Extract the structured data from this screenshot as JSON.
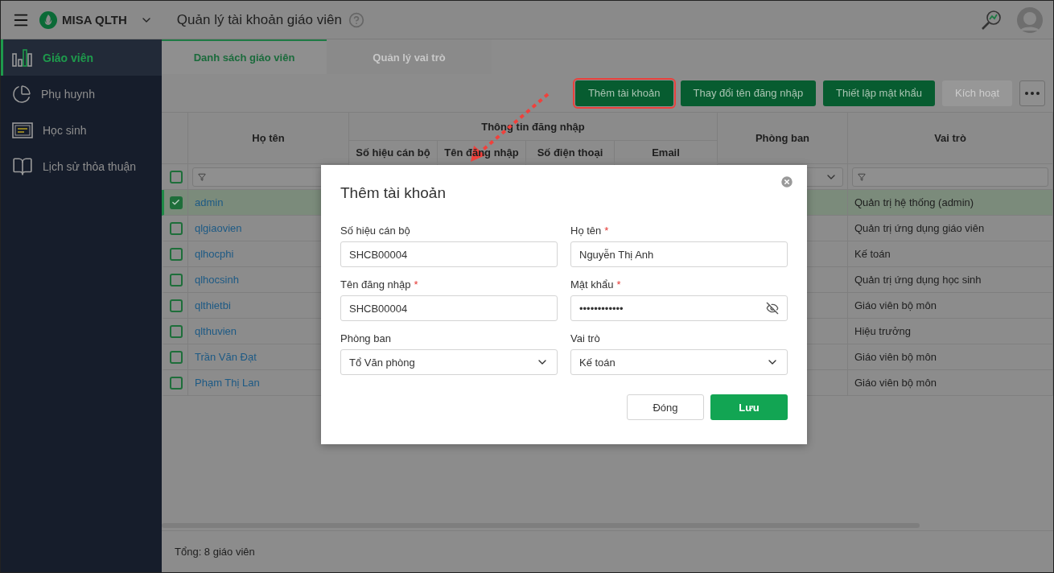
{
  "header": {
    "app_name": "MISA QLTH",
    "page_title": "Quản lý tài khoản giáo viên"
  },
  "sidebar": {
    "items": [
      {
        "label": "Giáo viên",
        "selected": true,
        "kind": "bars"
      },
      {
        "label": "Phụ huynh",
        "selected": false,
        "kind": "pie"
      },
      {
        "label": "Học sinh",
        "selected": false,
        "kind": "screen"
      },
      {
        "label": "Lịch sử thỏa thuận",
        "selected": false,
        "kind": "book"
      }
    ]
  },
  "tabs": [
    {
      "label": "Danh sách giáo viên",
      "selected": true
    },
    {
      "label": "Quản lý vai trò",
      "selected": false
    }
  ],
  "toolbar": {
    "buttons": [
      {
        "label": "Thêm tài khoản",
        "disabled": false,
        "highlighted": true
      },
      {
        "label": "Thay đổi tên đăng nhập",
        "disabled": false,
        "highlighted": false
      },
      {
        "label": "Thiết lập mật khẩu",
        "disabled": false,
        "highlighted": false
      },
      {
        "label": "Kích hoạt",
        "disabled": true,
        "highlighted": false
      }
    ]
  },
  "table": {
    "name_header": "Họ tên",
    "group_header": "Thông tin đăng nhập",
    "sub_headers": [
      "Số hiệu cán bộ",
      "Tên đăng nhập",
      "Số điện thoại",
      "Email"
    ],
    "department_header": "Phòng ban",
    "role_header": "Vai trò",
    "select_all": {
      "checked": false
    },
    "rows": [
      {
        "name": "admin",
        "role": "Quản trị hệ thống (admin)",
        "checked": true,
        "selected": true
      },
      {
        "name": "qlgiaovien",
        "role": "Quản trị ứng dụng giáo viên",
        "checked": false,
        "selected": false
      },
      {
        "name": "qlhocphi",
        "role": "Kế toán",
        "checked": false,
        "selected": false
      },
      {
        "name": "qlhocsinh",
        "role": "Quản trị ứng dụng học sinh",
        "checked": false,
        "selected": false
      },
      {
        "name": "qlthietbi",
        "role": "Giáo viên bộ môn",
        "checked": false,
        "selected": false
      },
      {
        "name": "qlthuvien",
        "role": "Hiệu trưởng",
        "checked": false,
        "selected": false
      },
      {
        "name": "Trần Văn Đạt",
        "role": "Giáo viên bộ môn",
        "checked": false,
        "selected": false
      },
      {
        "name": "Phạm Thị Lan",
        "role": "Giáo viên bộ môn",
        "checked": false,
        "selected": false
      }
    ]
  },
  "footer": "Tổng: 8 giáo viên",
  "dialog": {
    "title": "Thêm tài khoản",
    "fields": [
      {
        "label": "Số hiệu cán bộ",
        "required": false,
        "value": "SHCB00004",
        "kind": "text"
      },
      {
        "label": "Họ tên",
        "required": true,
        "value": "Nguyễn Thị Anh",
        "kind": "text"
      },
      {
        "label": "Tên đăng nhập",
        "required": true,
        "value": "SHCB00004",
        "kind": "text"
      },
      {
        "label": "Mật khẩu",
        "required": true,
        "value": "••••••••••••",
        "kind": "password"
      },
      {
        "label": "Phòng ban",
        "required": false,
        "value": "Tổ Văn phòng",
        "kind": "select"
      },
      {
        "label": "Vai trò",
        "required": false,
        "value": "Kế toán",
        "kind": "select"
      }
    ],
    "required_mark": "*",
    "buttons": [
      {
        "label": "Đóng",
        "kind": "secondary"
      },
      {
        "label": "Lưu",
        "kind": "primary"
      }
    ]
  }
}
